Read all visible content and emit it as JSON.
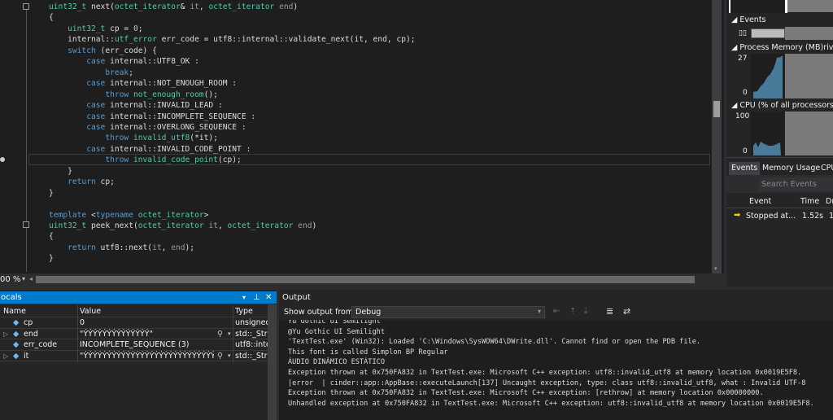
{
  "editor": {
    "zoom": "00 %",
    "lines": [
      [
        [
          "t",
          "uint32_t"
        ],
        [
          "",
          "&nbsp;next("
        ],
        [
          "t",
          "octet_iterator"
        ],
        [
          "",
          "& "
        ],
        [
          "p",
          "it"
        ],
        [
          "",
          ", "
        ],
        [
          "t",
          "octet_iterator"
        ],
        [
          "p",
          " end"
        ],
        [
          "",
          ")"
        ]
      ],
      [
        [
          "",
          "{"
        ]
      ],
      [
        [
          "",
          "    "
        ],
        [
          "t",
          "uint32_t"
        ],
        [
          "",
          " cp = "
        ],
        [
          "n",
          "0"
        ],
        [
          "",
          ";"
        ]
      ],
      [
        [
          "",
          "    internal::"
        ],
        [
          "t",
          "utf_error"
        ],
        [
          "",
          " err_code = utf8::internal::validate_next(it, end, cp);"
        ]
      ],
      [
        [
          "",
          "    "
        ],
        [
          "k",
          "switch"
        ],
        [
          "",
          " (err_code) {"
        ]
      ],
      [
        [
          "",
          "        "
        ],
        [
          "k",
          "case"
        ],
        [
          "",
          " internal::UTF8_OK :"
        ]
      ],
      [
        [
          "",
          "            "
        ],
        [
          "k",
          "break"
        ],
        [
          "",
          ";"
        ]
      ],
      [
        [
          "",
          "        "
        ],
        [
          "k",
          "case"
        ],
        [
          "",
          " internal::NOT_ENOUGH_ROOM :"
        ]
      ],
      [
        [
          "",
          "            "
        ],
        [
          "k",
          "throw"
        ],
        [
          "t",
          " not_enough_room"
        ],
        [
          "",
          "();"
        ]
      ],
      [
        [
          "",
          "        "
        ],
        [
          "k",
          "case"
        ],
        [
          "",
          " internal::INVALID_LEAD :"
        ]
      ],
      [
        [
          "",
          "        "
        ],
        [
          "k",
          "case"
        ],
        [
          "",
          " internal::INCOMPLETE_SEQUENCE :"
        ]
      ],
      [
        [
          "",
          "        "
        ],
        [
          "k",
          "case"
        ],
        [
          "",
          " internal::OVERLONG_SEQUENCE :"
        ]
      ],
      [
        [
          "",
          "            "
        ],
        [
          "k",
          "throw"
        ],
        [
          "t",
          " invalid_utf8"
        ],
        [
          "",
          "(*it);"
        ]
      ],
      [
        [
          "",
          "        "
        ],
        [
          "k",
          "case"
        ],
        [
          "",
          " internal::INVALID_CODE_POINT :"
        ]
      ],
      [
        [
          "",
          "            "
        ],
        [
          "k",
          "throw"
        ],
        [
          "t",
          " invalid_code_point"
        ],
        [
          "",
          "(cp);"
        ]
      ],
      [
        [
          "",
          "    }"
        ]
      ],
      [
        [
          "",
          "    "
        ],
        [
          "k",
          "return"
        ],
        [
          "",
          " cp;"
        ]
      ],
      [
        [
          "",
          "}"
        ]
      ],
      [],
      [
        [
          "k",
          "template"
        ],
        [
          "",
          " <"
        ],
        [
          "k",
          "typename"
        ],
        [
          "t",
          " octet_iterator"
        ],
        [
          "",
          ">"
        ]
      ],
      [
        [
          "t",
          "uint32_t"
        ],
        [
          "",
          " peek_next("
        ],
        [
          "t",
          "octet_iterator"
        ],
        [
          "p",
          " it"
        ],
        [
          "",
          ", "
        ],
        [
          "t",
          "octet_iterator"
        ],
        [
          "p",
          " end"
        ],
        [
          "",
          ")"
        ]
      ],
      [
        [
          "",
          "{"
        ]
      ],
      [
        [
          "",
          "    "
        ],
        [
          "k",
          "return"
        ],
        [
          "",
          " utf8::next("
        ],
        [
          "p",
          "it"
        ],
        [
          "",
          ", "
        ],
        [
          "p",
          "end"
        ],
        [
          "",
          ");"
        ]
      ],
      [
        [
          "",
          "}"
        ]
      ]
    ]
  },
  "diagnostics": {
    "events_label": "Events",
    "memory_label": "Process Memory (MB)rivate",
    "memory_max": "27",
    "memory_min": "0",
    "cpu_label": "CPU (% of all processors)",
    "cpu_max": "100",
    "cpu_min": "0",
    "tabs": [
      "Events",
      "Memory Usage",
      "CPU"
    ],
    "search_placeholder": "Search Events",
    "columns": [
      "Event",
      "Time",
      "Dı"
    ],
    "row": {
      "event": "Stopped at...",
      "time": "1.52s",
      "dur": "1"
    }
  },
  "locals": {
    "title": "ocals",
    "columns": [
      "Name",
      "Value",
      "Type"
    ],
    "rows": [
      {
        "name": "cp",
        "value": "0",
        "type": "unsigned"
      },
      {
        "name": "end",
        "value": "\"ÝÝÝÝÝÝÝÝÝÝÝÝÝÝ\"",
        "type": "std::_Strin"
      },
      {
        "name": "err_code",
        "value": "INCOMPLETE_SEQUENCE (3)",
        "type": "utf8::inte"
      },
      {
        "name": "it",
        "value": "\"ÝÝÝÝÝÝÝÝÝÝÝÝÝÝÝÝÝÝÝÝÝÝÝÝÝÝÝÝÝÝÝÝÝ",
        "type": "std::_Strin"
      }
    ]
  },
  "output": {
    "title": "Output",
    "show_from_label": "Show output from:",
    "source": "Debug",
    "lines": [
      "Yu Gothic UI Semilight",
      "@Yu Gothic UI Semilight",
      "'TextTest.exe' (Win32): Loaded 'C:\\Windows\\SysWOW64\\DWrite.dll'. Cannot find or open the PDB file.",
      "This font is called Simplon BP Regular",
      "ÁUDIO DINÂMICO ESTÁTICO",
      "Exception thrown at 0x750FA832 in TextTest.exe: Microsoft C++ exception: utf8::invalid_utf8 at memory location 0x0019E5F8.",
      "|error  | cinder::app::AppBase::executeLaunch[137] Uncaught exception, type: class utf8::invalid_utf8, what : Invalid UTF-8",
      "Exception thrown at 0x750FA832 in TextTest.exe: Microsoft C++ exception: [rethrow] at memory location 0x00000000.",
      "Unhandled exception at 0x750FA832 in TextTest.exe: Microsoft C++ exception: utf8::invalid_utf8 at memory location 0x0019E5F8."
    ]
  }
}
